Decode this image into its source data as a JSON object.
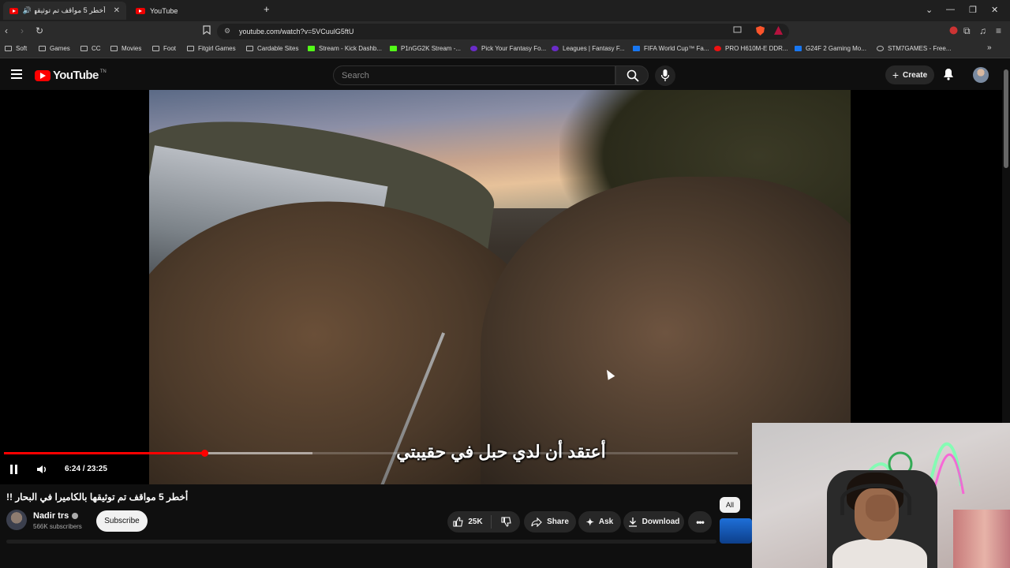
{
  "browser": {
    "tabs": [
      {
        "title": "أخطر 5 مواقف تم توثيقها بالكا...",
        "active": true
      },
      {
        "title": "YouTube",
        "active": false
      }
    ],
    "new_tab": "+",
    "url": "youtube.com/watch?v=5VCuulG5ftU",
    "window_controls": [
      "⌄",
      "—",
      "❐",
      "✕"
    ],
    "bookmarks": [
      {
        "label": "Soft",
        "icon": "folder-icon"
      },
      {
        "label": "Games",
        "icon": "folder-icon"
      },
      {
        "label": "CC",
        "icon": "folder-icon"
      },
      {
        "label": "Movies",
        "icon": "folder-icon"
      },
      {
        "label": "Foot",
        "icon": "folder-icon"
      },
      {
        "label": "Fitgirl Games",
        "icon": "folder-icon"
      },
      {
        "label": "Cardable Sites",
        "icon": "folder-icon"
      },
      {
        "label": "Stream - Kick Dashb...",
        "icon": "kick-icon"
      },
      {
        "label": "P1nGG2K Stream -...",
        "icon": "kick-icon"
      },
      {
        "label": "Pick Your Fantasy Fo...",
        "icon": "fantasy-icon"
      },
      {
        "label": "Leagues | Fantasy F...",
        "icon": "fantasy-icon"
      },
      {
        "label": "FIFA World Cup™ Fa...",
        "icon": "facebook-icon"
      },
      {
        "label": "PRO H610M-E DDR...",
        "icon": "asus-icon"
      },
      {
        "label": "G24F 2 Gaming Mo...",
        "icon": "gigabyte-icon"
      },
      {
        "label": "STM7GAMES - Free...",
        "icon": "steam-icon"
      }
    ],
    "more_bookmarks": "»"
  },
  "youtube": {
    "logo_text": "YouTube",
    "logo_tm": "TN",
    "search_placeholder": "Search",
    "create_label": "Create"
  },
  "player": {
    "subtitle": "أعتقد أن لدي حبل في حقيبتي",
    "time_text": "6:24 / 23:25",
    "progress_fraction": 0.273,
    "buffer_fraction": 0.42,
    "state": "playing"
  },
  "video_info": {
    "title": "أخطر 5 مواقف تم توثيقها بالكاميرا في البحار !!",
    "channel_name": "Nadir trs",
    "subscribers": "566K subscribers",
    "subscribe_label": "Subscribe",
    "like_count": "25K",
    "share_label": "Share",
    "ask_label": "Ask",
    "download_label": "Download"
  },
  "sidebar": {
    "chip_all": "All"
  },
  "colors": {
    "accent": "#ff0000",
    "background": "#0f0f0f"
  }
}
